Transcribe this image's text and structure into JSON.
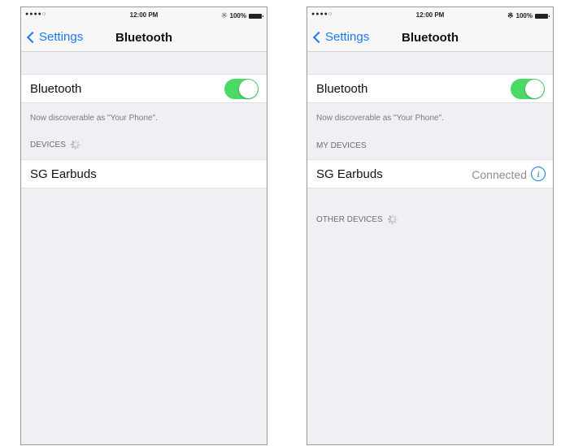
{
  "accent_color": "#1a7ce6",
  "toggle_on_color": "#4cd964",
  "left_screen": {
    "status_bar": {
      "signal": "●●●●○",
      "time": "12:00 PM",
      "battery": "100%"
    },
    "nav": {
      "back_label": "Settings",
      "title": "Bluetooth"
    },
    "bluetooth_row": {
      "label": "Bluetooth",
      "toggle_on": true
    },
    "discoverable_note": "Now discoverable as \"Your Phone\".",
    "devices_header": "DEVICES",
    "devices": [
      {
        "name": "SG Earbuds"
      }
    ]
  },
  "right_screen": {
    "status_bar": {
      "signal": "●●●●○",
      "time": "12:00 PM",
      "battery": "100%"
    },
    "nav": {
      "back_label": "Settings",
      "title": "Bluetooth"
    },
    "bluetooth_row": {
      "label": "Bluetooth",
      "toggle_on": true
    },
    "discoverable_note": "Now discoverable as \"Your Phone\".",
    "my_devices_header": "MY DEVICES",
    "my_devices": [
      {
        "name": "SG Earbuds",
        "status": "Connected"
      }
    ],
    "other_devices_header": "OTHER DEVICES"
  },
  "icons": [
    "chevron-left-icon",
    "bluetooth-icon",
    "battery-icon",
    "spinner-icon",
    "info-icon"
  ]
}
